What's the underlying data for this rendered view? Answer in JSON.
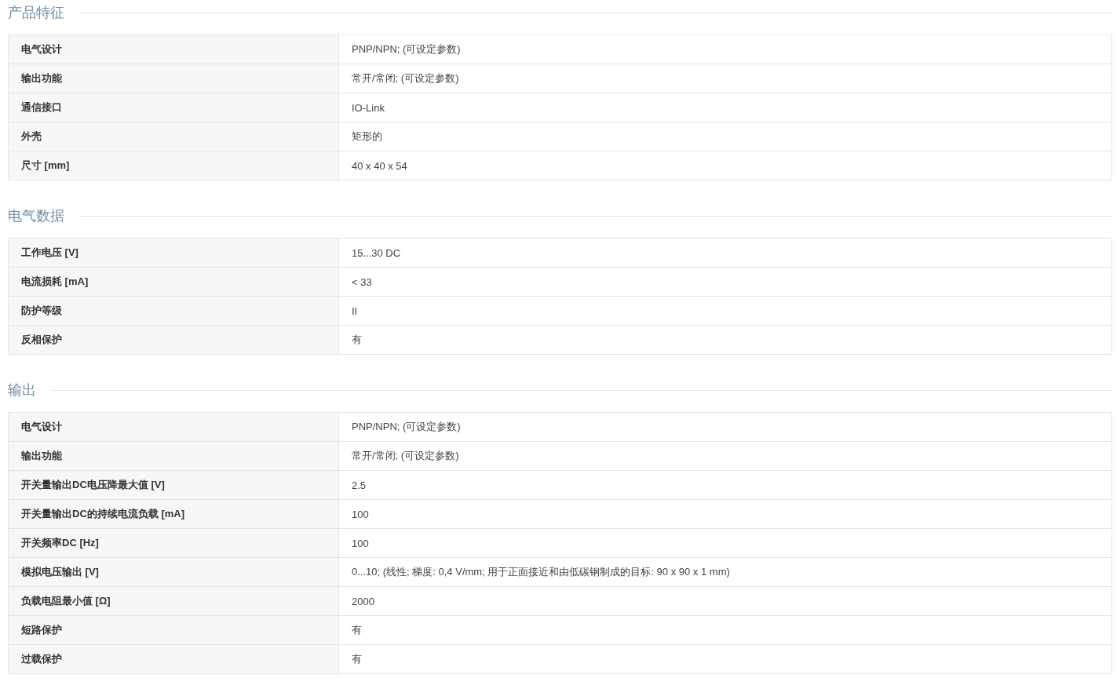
{
  "sections": [
    {
      "title": "产品特征",
      "rows": [
        {
          "label": "电气设计",
          "value": "PNP/NPN; (可设定参数)"
        },
        {
          "label": "输出功能",
          "value": "常开/常闭; (可设定参数)"
        },
        {
          "label": "通信接口",
          "value": "IO-Link"
        },
        {
          "label": "外壳",
          "value": "矩形的"
        },
        {
          "label": "尺寸 [mm]",
          "value": "40 x 40 x 54"
        }
      ]
    },
    {
      "title": "电气数据",
      "rows": [
        {
          "label": "工作电压 [V]",
          "value": "15...30 DC"
        },
        {
          "label": "电流损耗 [mA]",
          "value": "< 33"
        },
        {
          "label": "防护等级",
          "value": "II"
        },
        {
          "label": "反相保护",
          "value": "有"
        }
      ]
    },
    {
      "title": "输出",
      "rows": [
        {
          "label": "电气设计",
          "value": "PNP/NPN; (可设定参数)"
        },
        {
          "label": "输出功能",
          "value": "常开/常闭; (可设定参数)"
        },
        {
          "label": "开关量输出DC电压降最大值 [V]",
          "value": "2.5"
        },
        {
          "label": "开关量输出DC的持续电流负载 [mA]",
          "value": "100"
        },
        {
          "label": "开关频率DC [Hz]",
          "value": "100"
        },
        {
          "label": "模拟电压输出 [V]",
          "value": "0...10; (线性; 梯度: 0,4 V/mm; 用于正面接近和由低碳钢制成的目标: 90 x 90 x 1 mm)"
        },
        {
          "label": "负载电阻最小值 [Ω]",
          "value": "2000"
        },
        {
          "label": "短路保护",
          "value": "有"
        },
        {
          "label": "过载保护",
          "value": "有"
        }
      ]
    }
  ]
}
